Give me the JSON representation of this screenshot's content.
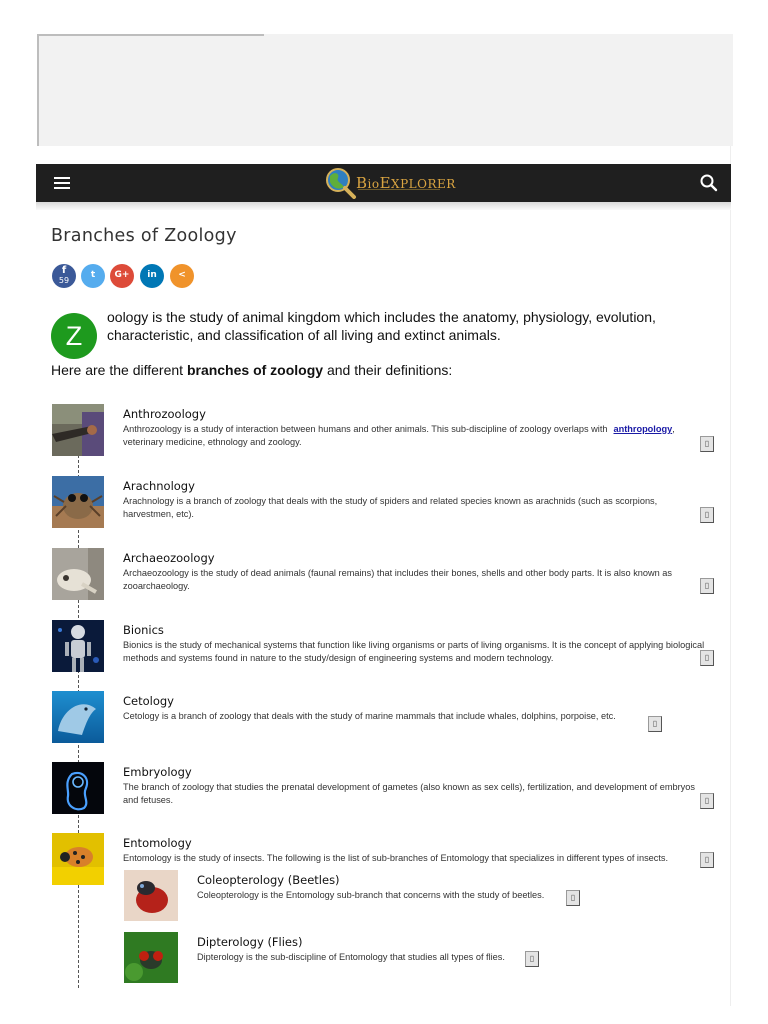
{
  "header": {
    "logo_text_big": "B",
    "logo_text": "io",
    "logo_text_big2": "E",
    "logo_text2": "XPLORER"
  },
  "article": {
    "title": "Branches of Zoology",
    "share": {
      "facebook_count": "59",
      "facebook_glyph": "f",
      "twitter_glyph": "t",
      "google_glyph": "G+",
      "linkedin_glyph": "in",
      "share_glyph": "<"
    },
    "dropcap": "Z",
    "intro": "oology is the study of animal kingdom which includes the anatomy, physiology, evolution, characteristic, and classification of all living and extinct animals.",
    "lead_prefix": "Here are the different ",
    "lead_bold": "branches of zoology",
    "lead_suffix": " and their definitions:"
  },
  "branches": [
    {
      "title": "Anthrozoology",
      "text": "Anthrozoology is a study of interaction between humans and other animals. This sub-discipline of zoology overlaps with",
      "link": "anthropology",
      "text_after": ", veterinary medicine, ethnology and zoology."
    },
    {
      "title": "Arachnology",
      "text": "Arachnology is a branch of zoology that deals with the study of spiders and related species known as arachnids (such as scorpions, harvestmen, etc)."
    },
    {
      "title": "Archaeozoology",
      "text": "Archaeozoology is the study of dead animals (faunal remains) that includes their bones, shells and other body parts. It is also known as zooarchaeology."
    },
    {
      "title": "Bionics",
      "text": "Bionics is the study of mechanical systems that function like living organisms or parts of living organisms. It is the concept of applying biological methods and systems found in nature to the study/design of engineering systems and modern technology."
    },
    {
      "title": "Cetology",
      "text": "Cetology is a branch of zoology that deals with the study of marine mammals that include whales, dolphins, porpoise, etc."
    },
    {
      "title": "Embryology",
      "text": "The branch of zoology that studies the prenatal development of gametes (also known as sex cells), fertilization, and development of embryos and fetuses."
    },
    {
      "title": "Entomology",
      "text": "Entomology is the study of insects. The following is the list of sub-branches of Entomology that specializes in different types of insects."
    }
  ],
  "sub_branches": [
    {
      "title": "Coleopterology (Beetles)",
      "text": "Coleopterology is the Entomology sub-branch that concerns with the study of beetles."
    },
    {
      "title": "Dipterology (Flies)",
      "text": "Dipterology is the sub-discipline of Entomology that studies all types of flies."
    }
  ],
  "expand_glyph": "▯",
  "colors": {
    "navbar": "#1f1f1f",
    "dropcap": "#1e9a1e",
    "facebook": "#3b5998",
    "twitter": "#55acee",
    "google": "#dd4b39",
    "linkedin": "#0077b5",
    "share": "#f0932b",
    "link": "#1a1aa6"
  }
}
